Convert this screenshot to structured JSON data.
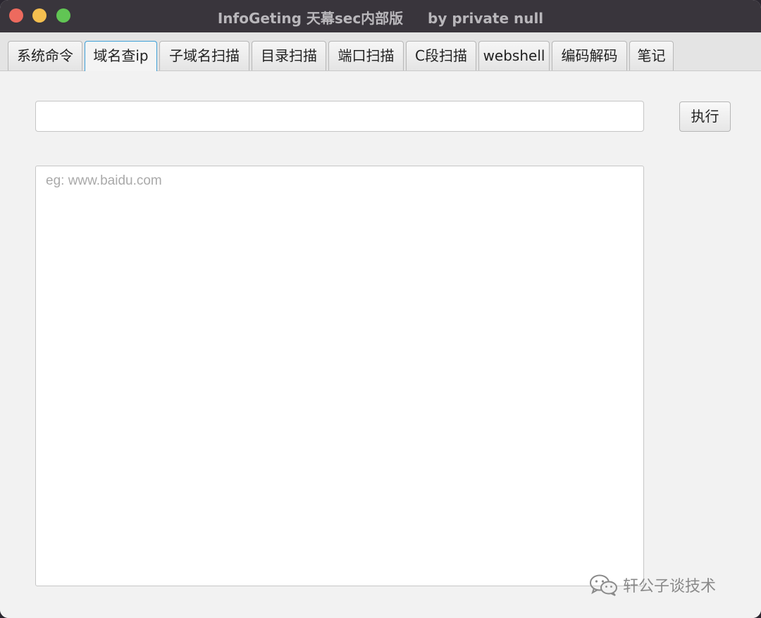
{
  "window": {
    "title": "InfoGeting 天幕sec内部版     by private null"
  },
  "tabs": [
    {
      "label": "系统命令"
    },
    {
      "label": "域名查ip"
    },
    {
      "label": "子域名扫描"
    },
    {
      "label": "目录扫描"
    },
    {
      "label": "端口扫描"
    },
    {
      "label": "C段扫描"
    },
    {
      "label": "webshell"
    },
    {
      "label": "编码解码"
    },
    {
      "label": "笔记"
    }
  ],
  "active_tab": "域名查ip",
  "main": {
    "input_value": "",
    "execute_label": "执行",
    "output_placeholder": "eg: www.baidu.com"
  },
  "watermark": {
    "text": "轩公子谈技术",
    "icon": "wechat-icon"
  },
  "colors": {
    "titlebar": "#39353c",
    "active_tab_border": "#3ea0d8",
    "close": "#ed6a5e",
    "minimize": "#f5bf4f",
    "maximize": "#61c554"
  }
}
